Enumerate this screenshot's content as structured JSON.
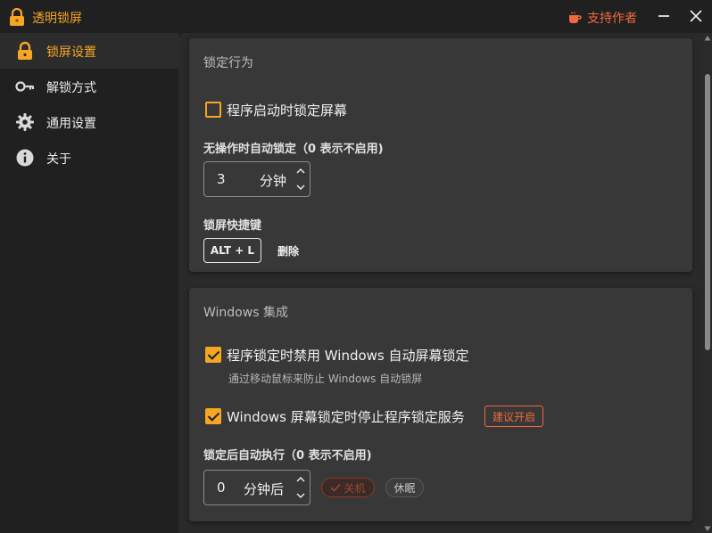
{
  "window": {
    "title": "透明锁屏",
    "support_label": "支持作者",
    "accent": "#f5a623",
    "support_color": "#ef6a3e"
  },
  "sidebar": {
    "items": [
      {
        "label": "锁屏设置",
        "icon": "lock-icon",
        "active": true
      },
      {
        "label": "解锁方式",
        "icon": "key-icon",
        "active": false
      },
      {
        "label": "通用设置",
        "icon": "gear-icon",
        "active": false
      },
      {
        "label": "关于",
        "icon": "info-icon",
        "active": false
      }
    ]
  },
  "lock_behavior": {
    "title": "锁定行为",
    "lock_on_start": {
      "label": "程序启动时锁定屏幕",
      "checked": false
    },
    "idle_lock": {
      "title": "无操作时自动锁定（0 表示不启用)",
      "value": "3",
      "unit": "分钟"
    },
    "hotkey": {
      "title": "锁屏快捷键",
      "value": "ALT + L",
      "delete_label": "删除"
    }
  },
  "windows_integration": {
    "title": "Windows 集成",
    "disable_windows_lock": {
      "label": "程序锁定时禁用 Windows 自动屏幕锁定",
      "description": "通过移动鼠标来防止 Windows 自动锁屏",
      "checked": true
    },
    "stop_on_windows_lock": {
      "label": "Windows 屏幕锁定时停止程序锁定服务",
      "badge": "建议开启",
      "checked": true
    },
    "after_lock": {
      "title": "锁定后自动执行（0 表示不启用)",
      "value": "0",
      "unit": "分钟后",
      "shutdown_label": "关机",
      "sleep_label": "休眠"
    }
  }
}
